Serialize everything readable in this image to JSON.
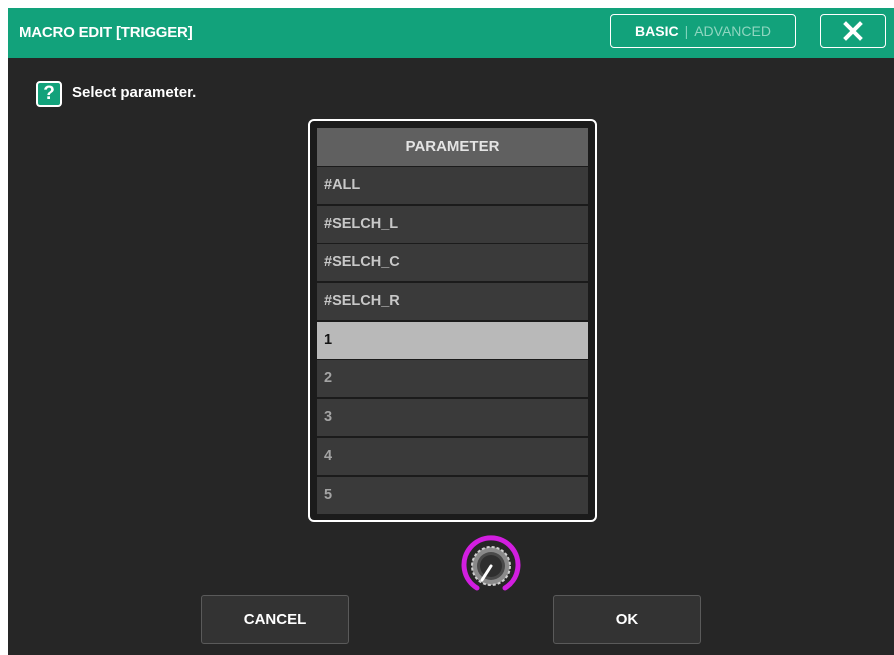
{
  "window": {
    "title": "MACRO EDIT [TRIGGER]"
  },
  "mode_toggle": {
    "basic": "BASIC",
    "separator": "|",
    "advanced": "ADVANCED"
  },
  "close_icon": "close-x-icon",
  "help_icon": {
    "name": "help-icon",
    "glyph": "?"
  },
  "prompt": "Select parameter.",
  "list": {
    "header": "PARAMETER",
    "items": [
      "#ALL",
      "#SELCH_L",
      "#SELCH_C",
      "#SELCH_R",
      "1",
      "2",
      "3",
      "4",
      "5"
    ],
    "selected": "1"
  },
  "knob_icon": "rotary-encoder-icon",
  "buttons": {
    "cancel": "CANCEL",
    "ok": "OK"
  },
  "colors": {
    "accent": "#12a27b",
    "knob_ring": "#d21ee0",
    "selected_row": "#b9b9b9"
  }
}
